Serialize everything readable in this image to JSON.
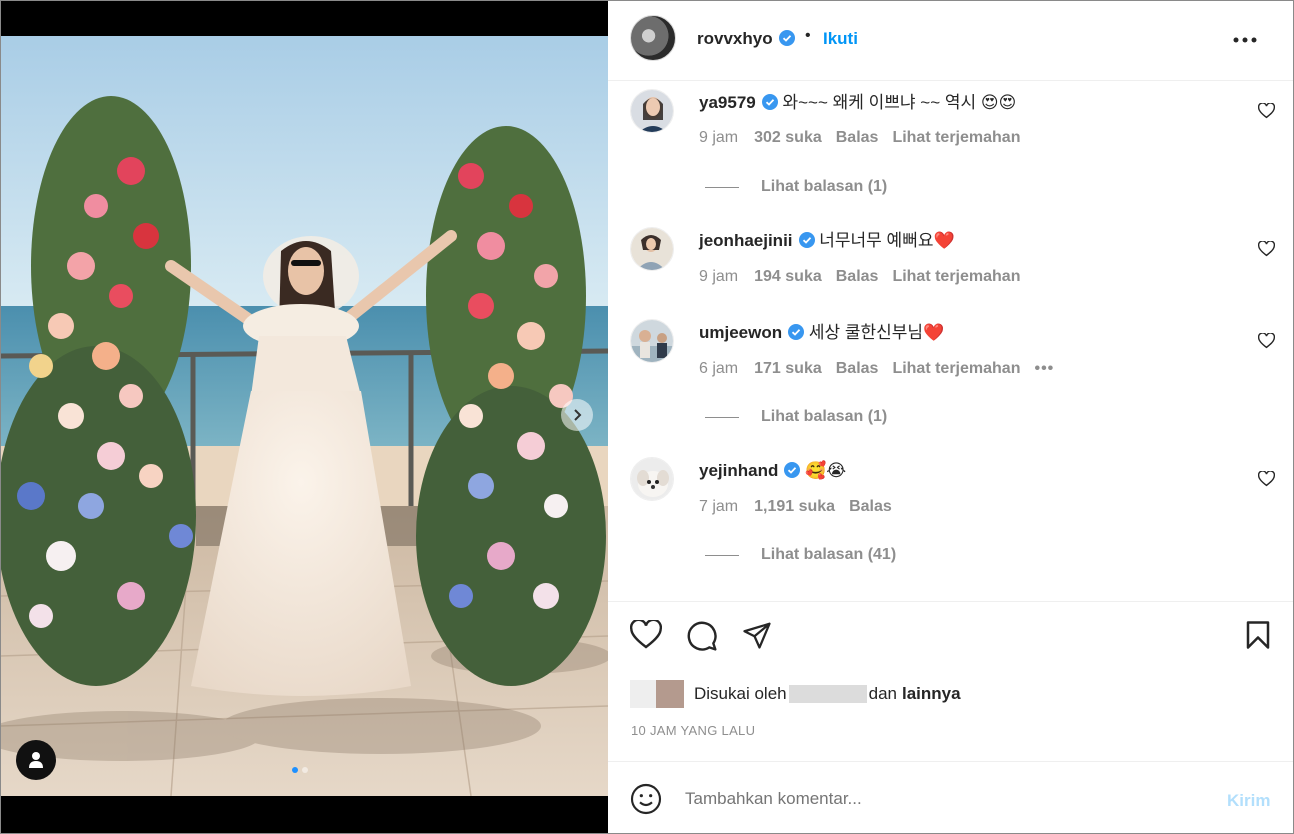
{
  "post": {
    "username": "rovvxhyo",
    "separator": "•",
    "follow_label": "Ikuti",
    "image_count": 2,
    "active_image": 1
  },
  "comments": [
    {
      "username": "ya9579",
      "text": "와~~~ 왜케 이쁘냐 ~~ 역시 😍😍",
      "time": "9 jam",
      "likes": "302 suka",
      "reply": "Balas",
      "translate": "Lihat terjemahan",
      "view_replies": "Lihat balasan (1)"
    },
    {
      "username": "jeonhaejinii",
      "text": "너무너무 예뻐요❤️",
      "time": "9 jam",
      "likes": "194 suka",
      "reply": "Balas",
      "translate": "Lihat terjemahan"
    },
    {
      "username": "umjeewon",
      "text": "세상 쿨한신부님❤️",
      "time": "6 jam",
      "likes": "171 suka",
      "reply": "Balas",
      "translate": "Lihat terjemahan",
      "more": "•••",
      "view_replies": "Lihat balasan (1)"
    },
    {
      "username": "yejinhand",
      "text": "🥰😭",
      "time": "7 jam",
      "likes": "1,191 suka",
      "reply": "Balas",
      "view_replies": "Lihat balasan (41)"
    }
  ],
  "likes_line": {
    "prefix": "Disukai oleh",
    "middle": "dan",
    "suffix": "lainnya"
  },
  "timestamp": "10 JAM YANG LALU",
  "composer": {
    "placeholder": "Tambahkan komentar...",
    "send_label": "Kirim"
  },
  "colors": {
    "accent": "#0095f6",
    "verified": "#3897f0",
    "muted": "#8e8e8e",
    "send_disabled": "#b2dffc"
  }
}
